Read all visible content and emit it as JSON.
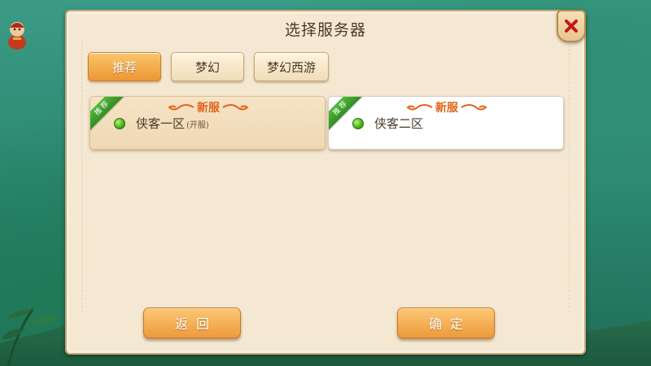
{
  "dialog": {
    "title": "选择服务器"
  },
  "tabs": [
    {
      "label": "推荐",
      "active": true
    },
    {
      "label": "梦幻",
      "active": false
    },
    {
      "label": "梦幻西游",
      "active": false
    }
  ],
  "servers": [
    {
      "badge": "推荐",
      "tag": "新服",
      "name": "侠客一区",
      "note": "(开服)",
      "status_color": "#4cb51f"
    },
    {
      "badge": "推荐",
      "tag": "新服",
      "name": "侠客二区",
      "note": "",
      "status_color": "#4cb51f"
    }
  ],
  "buttons": {
    "back_label": "返回",
    "confirm_label": "确定"
  },
  "icons": {
    "close": "close-icon",
    "status": "status-dot-icon"
  },
  "colors": {
    "panel_bg": "#f4e8d3",
    "accent_orange": "#ee9a3a",
    "badge_green": "#2f8f22",
    "new_tag": "#e0641a"
  }
}
